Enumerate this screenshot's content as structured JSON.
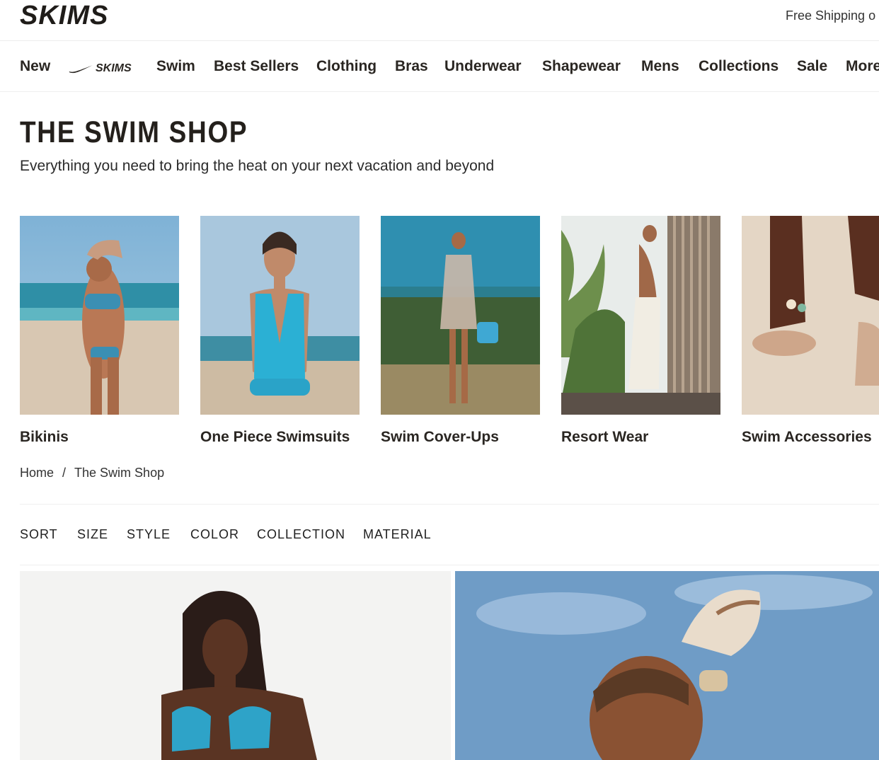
{
  "header": {
    "logo_text": "SKIMS",
    "shipping_text": "Free Shipping o"
  },
  "nav": {
    "items": [
      {
        "label": "New"
      },
      {
        "label": "Swim"
      },
      {
        "label": "Best Sellers"
      },
      {
        "label": "Clothing"
      },
      {
        "label": "Bras"
      },
      {
        "label": "Underwear"
      },
      {
        "label": "Shapewear"
      },
      {
        "label": "Mens"
      },
      {
        "label": "Collections"
      },
      {
        "label": "Sale"
      },
      {
        "label": "More"
      }
    ],
    "collab_logo_text": "SKIMS"
  },
  "page": {
    "title": "THE SWIM SHOP",
    "subtitle": "Everything you need to bring the heat on your next vacation and beyond"
  },
  "categories": [
    {
      "label": "Bikinis"
    },
    {
      "label": "One Piece Swimsuits"
    },
    {
      "label": "Swim Cover-Ups"
    },
    {
      "label": "Resort Wear"
    },
    {
      "label": "Swim Accessories"
    }
  ],
  "breadcrumb": {
    "home": "Home",
    "separator": "/",
    "current": "The Swim Shop"
  },
  "filters": [
    "SORT",
    "SIZE",
    "STYLE",
    "COLOR",
    "COLLECTION",
    "MATERIAL"
  ],
  "colors": {
    "text": "#2a2622",
    "border": "#efefef"
  }
}
